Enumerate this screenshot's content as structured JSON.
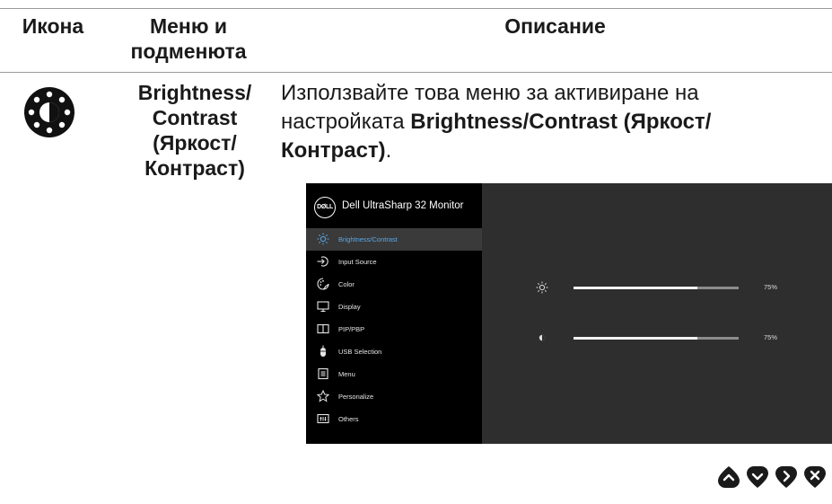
{
  "table": {
    "headers": {
      "icon": "Икона",
      "menu": "Меню и подменюта",
      "description": "Описание"
    },
    "row": {
      "icon_name": "brightness-contrast-icon",
      "submenu": [
        "Brightness/",
        "Contrast",
        "(Яркост/",
        "Контраст)"
      ],
      "description": {
        "part1": "Използвайте това меню за активиране на настройката ",
        "bold": "Brightness/Contrast (Яркост/ Контраст)",
        "part2": "."
      }
    }
  },
  "osd": {
    "logo": "DØLL",
    "title": "Dell UltraSharp 32 Monitor",
    "menu": [
      {
        "label": "Brightness/Contrast",
        "icon": "brightness-icon",
        "active": true
      },
      {
        "label": "Input Source",
        "icon": "input-source-icon",
        "active": false
      },
      {
        "label": "Color",
        "icon": "color-icon",
        "active": false
      },
      {
        "label": "Display",
        "icon": "display-icon",
        "active": false
      },
      {
        "label": "PIP/PBP",
        "icon": "pip-pbp-icon",
        "active": false
      },
      {
        "label": "USB Selection",
        "icon": "usb-mouse-icon",
        "active": false
      },
      {
        "label": "Menu",
        "icon": "menu-icon",
        "active": false
      },
      {
        "label": "Personalize",
        "icon": "star-icon",
        "active": false
      },
      {
        "label": "Others",
        "icon": "others-icon",
        "active": false
      }
    ],
    "sliders": [
      {
        "name": "brightness",
        "icon": "brightness-icon",
        "value": 0.75,
        "label": "75%"
      },
      {
        "name": "contrast",
        "icon": "contrast-icon",
        "value": 0.75,
        "label": "75%"
      }
    ]
  },
  "nav_buttons": [
    "up-icon",
    "down-icon",
    "right-icon",
    "close-icon"
  ],
  "colors": {
    "osd_bg": "#2e2e2e",
    "osd_menu_bg": "#000000",
    "active_text": "#58a8e8"
  }
}
